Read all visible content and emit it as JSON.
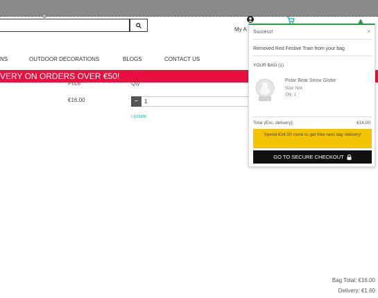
{
  "header": {
    "search": {
      "placeholder": "",
      "value": ""
    },
    "account_label": "My A",
    "icons": {
      "search": "search-icon",
      "account": "user-icon",
      "cart": "cart-icon"
    }
  },
  "nav": {
    "items": [
      "NS",
      "OUTDOOR DECORATIONS",
      "BLOGS",
      "CONTACT US"
    ]
  },
  "promo": {
    "text": "VERY ON ORDERS OVER €50!",
    "color": "#e8103e"
  },
  "bag_table": {
    "headers": {
      "price": "Price",
      "qty": "Qty"
    },
    "row": {
      "price": "€16.00",
      "qty": "1",
      "update_label": "Update"
    }
  },
  "popup": {
    "title": "Success!",
    "close": "×",
    "message": "Removed Red Festive Train from your bag",
    "bag_heading": "YOUR BAG (1)",
    "item": {
      "name": "Polar Bear Snow Globe",
      "size": "Size: N/A",
      "qty": "Qty: 1"
    },
    "total_label": "Total (Exc. delivery):",
    "total_value": "€16.00",
    "banner": "Spend €34.00 more to get free next day delivery!",
    "checkout_label": "GO TO SECURE CHECKOUT",
    "accent_color": "#2a9a4a",
    "banner_color": "#f5c400"
  },
  "summary": {
    "bag_total": "Bag Total: €16.00",
    "delivery": "Delivery: €1.60"
  }
}
